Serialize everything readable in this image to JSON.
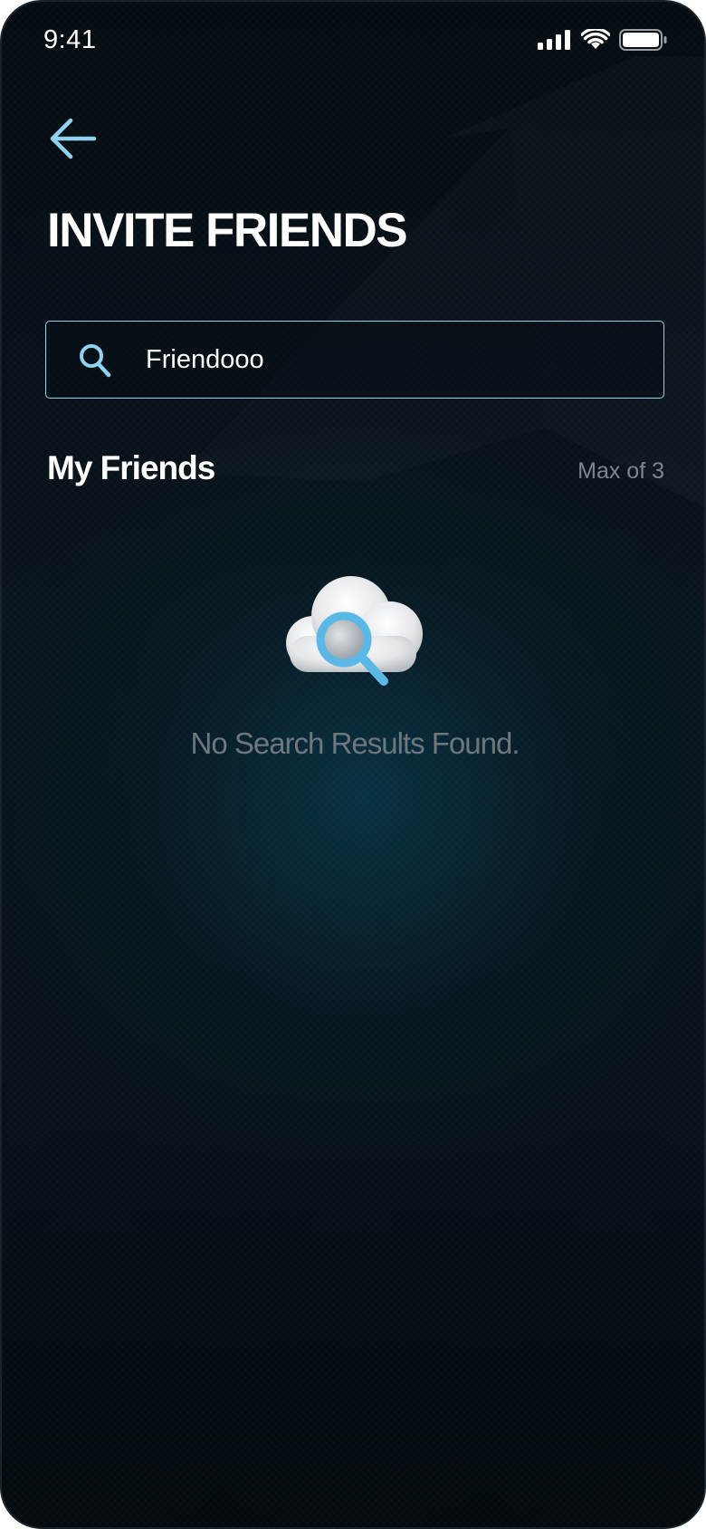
{
  "status_bar": {
    "time": "9:41",
    "icons": [
      "signal-icon",
      "wifi-icon",
      "battery-icon"
    ]
  },
  "header": {
    "back_icon": "arrow-left-icon",
    "title": "INVITE FRIENDS"
  },
  "search": {
    "icon": "search-icon",
    "value": "Friendooo"
  },
  "friends_section": {
    "title": "My Friends",
    "max_label": "Max of 3"
  },
  "empty_state": {
    "illustration": "cloud-search-icon",
    "message": "No Search Results Found."
  },
  "colors": {
    "accent": "#8fd3f0",
    "background": "#071219",
    "muted_text": "#7c868c"
  }
}
